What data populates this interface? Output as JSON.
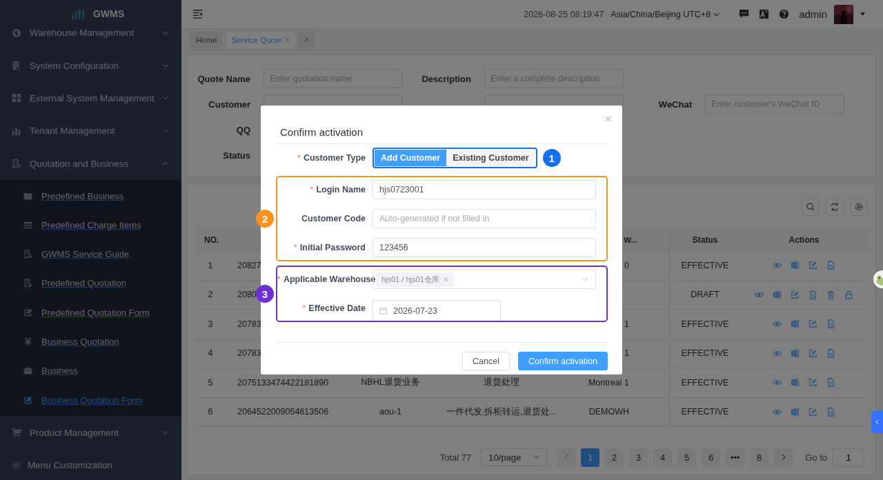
{
  "sidebar": {
    "logo": "GWMS",
    "items": [
      {
        "label": "Warehouse Management",
        "expanded": false
      },
      {
        "label": "System Configuration",
        "expanded": false
      },
      {
        "label": "External System Management",
        "expanded": false
      },
      {
        "label": "Tenant Management",
        "expanded": false
      },
      {
        "label": "Quotation and Business",
        "expanded": true,
        "children": [
          {
            "label": "Predefined Business",
            "selected": false
          },
          {
            "label": "Predefined Charge Items",
            "selected": false
          },
          {
            "label": "GWMS Service Guide",
            "selected": false
          },
          {
            "label": "Predefined Quotation",
            "selected": false
          },
          {
            "label": "Predefined Quotation Form",
            "selected": false
          },
          {
            "label": "Business Quotation",
            "selected": false
          },
          {
            "label": "Business",
            "selected": false
          },
          {
            "label": "Business Quotation Form",
            "selected": true
          }
        ]
      },
      {
        "label": "Product Management",
        "expanded": false
      }
    ],
    "footer": "Menu Customization"
  },
  "header": {
    "datetime": "2026-08-25 08:19:47",
    "timezone": "Asia/China/Beijing UTC+8",
    "user": "admin"
  },
  "tabs": [
    {
      "label": "Home",
      "selected": false,
      "closable": false
    },
    {
      "label": "Service Quote",
      "selected": true,
      "closable": true
    },
    {
      "selected": false,
      "closable": true
    }
  ],
  "search_form": {
    "rows": [
      [
        {
          "label": "Quote Name",
          "kind": "input",
          "placeholder": "Enter quotation name"
        },
        {
          "label": "Description",
          "kind": "input",
          "placeholder": "Enter a complete description"
        }
      ],
      [
        {
          "label": "Customer",
          "kind": "input"
        },
        {
          "kind": "input"
        },
        {
          "label": "WeChat",
          "kind": "input",
          "placeholder": "Enter customer's WeChat ID"
        }
      ],
      [
        {
          "label": "QQ",
          "kind": "label"
        }
      ],
      [
        {
          "label": "Status",
          "kind": "label"
        }
      ]
    ]
  },
  "table": {
    "columns": {
      "no": "NO.",
      "column_5": "W...",
      "status": "Status",
      "actions": "Actions"
    },
    "rows": [
      {
        "no": "1",
        "id": "20827",
        "column_5": "0",
        "status": "EFFECTIVE",
        "actions": [
          {
            "kind": "view"
          },
          {
            "kind": "excel"
          },
          {
            "kind": "edit"
          },
          {
            "kind": "document"
          }
        ]
      },
      {
        "no": "2",
        "id": "2080",
        "status": "DRAFT",
        "actions": [
          {
            "kind": "view"
          },
          {
            "kind": "excel"
          },
          {
            "kind": "edit"
          },
          {
            "kind": "document"
          },
          {
            "kind": "delete"
          },
          {
            "kind": "lock"
          }
        ]
      },
      {
        "no": "3",
        "id": "20783",
        "column_5": "1",
        "status": "EFFECTIVE",
        "actions": [
          {
            "kind": "view"
          },
          {
            "kind": "excel"
          },
          {
            "kind": "edit"
          },
          {
            "kind": "document"
          }
        ]
      },
      {
        "no": "4",
        "id": "20783",
        "column_5": "1",
        "status": "EFFECTIVE",
        "actions": [
          {
            "kind": "view"
          },
          {
            "kind": "excel"
          },
          {
            "kind": "edit"
          },
          {
            "kind": "document"
          }
        ]
      },
      {
        "no": "5",
        "id": "2075133474422181890",
        "column_3": "NBHL退货业务",
        "column_4": "退货处理",
        "column_5": "Montreal 1",
        "status": "EFFECTIVE",
        "actions": [
          {
            "kind": "view"
          },
          {
            "kind": "excel"
          },
          {
            "kind": "edit"
          },
          {
            "kind": "document"
          }
        ]
      },
      {
        "no": "6",
        "id": "2064522009054613506",
        "column_3": "aou-1",
        "column_4": "一件代发,拆柜转运,退货处...",
        "column_5": "DEMOWH",
        "status": "EFFECTIVE",
        "actions": [
          {
            "kind": "view"
          },
          {
            "kind": "excel"
          },
          {
            "kind": "edit"
          },
          {
            "kind": "document"
          }
        ]
      }
    ]
  },
  "pagination": {
    "total": "Total 77",
    "page_size": "10/page",
    "pages": [
      {
        "label": "1",
        "selected": true
      },
      {
        "label": "2",
        "selected": false
      },
      {
        "label": "3",
        "selected": false
      },
      {
        "label": "4",
        "selected": false
      },
      {
        "label": "5",
        "selected": false
      },
      {
        "label": "6",
        "selected": false
      },
      {
        "label": "•••",
        "selected": false
      },
      {
        "label": "8",
        "selected": false
      }
    ],
    "goto_label": "Go to",
    "goto_value": "1"
  },
  "dialog": {
    "title": "Confirm activation",
    "groups": [
      {
        "kind": "control",
        "annotation": {
          "number": "1",
          "color": "#1570ef"
        },
        "fields": [
          {
            "mark": "*",
            "label": "Customer Type",
            "kind": "segmented",
            "options": [
              {
                "label": "Add Customer",
                "selected": true
              },
              {
                "label": "Existing Customer",
                "selected": false
              }
            ]
          }
        ]
      },
      {
        "kind": "rows",
        "annotation": {
          "number": "2",
          "color": "#f7931e"
        },
        "fields": [
          {
            "mark": "*",
            "label": "Login Name",
            "kind": "text",
            "value": "hjs0723001"
          },
          {
            "label": "Customer Code",
            "kind": "text",
            "placeholder": "Auto-generated if not filled in"
          },
          {
            "mark": "*",
            "label": "Initial Password",
            "kind": "text",
            "value": "123456"
          }
        ]
      },
      {
        "kind": "rows",
        "annotation": {
          "number": "3",
          "color": "#6d2fd6"
        },
        "fields": [
          {
            "mark": "*",
            "label": "Applicable Warehouse",
            "kind": "tags",
            "tags": [
              "hjs01 / hjs01仓库"
            ]
          },
          {
            "mark": "*",
            "label": "Effective Date",
            "kind": "date",
            "value": "2026-07-23"
          }
        ]
      }
    ],
    "buttons": [
      {
        "label": "Cancel",
        "kind": "default"
      },
      {
        "label": "Confirm activation",
        "kind": "primary"
      }
    ]
  }
}
